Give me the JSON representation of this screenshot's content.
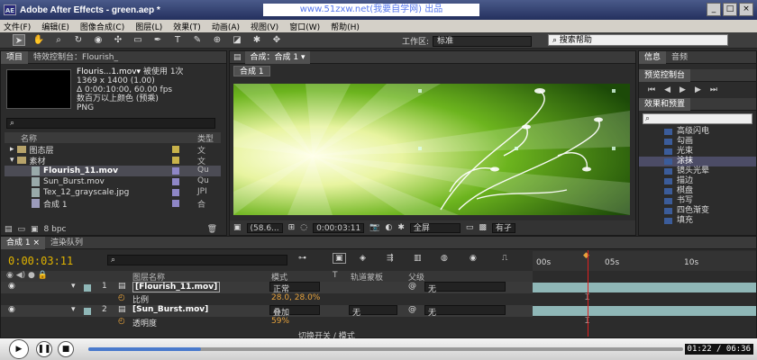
{
  "window": {
    "title": "Adobe After Effects - green.aep *",
    "watermark": "www.51zxw.net(我要自学网) 出品",
    "app_icon": "AE"
  },
  "menu": [
    "文件(F)",
    "编辑(E)",
    "图像合成(C)",
    "图层(L)",
    "效果(T)",
    "动画(A)",
    "视图(V)",
    "窗口(W)",
    "帮助(H)"
  ],
  "toolbar": {
    "workspace_label": "工作区:",
    "workspace_value": "标准",
    "help_search": "搜索帮助"
  },
  "project": {
    "tabs": [
      "项目",
      "特效控制台：Flourish_"
    ],
    "info": {
      "name": "Flouris...1.mov▾",
      "used": "被使用 1次",
      "dims": "1369 x 1400 (1.00)",
      "duration": "Δ 0:00:10:00, 60.00 fps",
      "color": "数百万以上颜色 (预乘)",
      "codec": "PNG"
    },
    "col_name": "名称",
    "col_type": "类型",
    "items": [
      {
        "name": "图态层",
        "type": "文",
        "kind": "folder",
        "color": "#c8b24a"
      },
      {
        "name": "素材",
        "type": "文",
        "kind": "folder",
        "color": "#c8b24a"
      },
      {
        "name": "Flourish_11.mov",
        "type": "Qu",
        "kind": "file",
        "color": "#8e86c6",
        "selected": true
      },
      {
        "name": "Sun_Burst.mov",
        "type": "Qu",
        "kind": "file",
        "color": "#8e86c6"
      },
      {
        "name": "Tex_12_grayscale.jpg",
        "type": "JPI",
        "kind": "file",
        "color": "#8e86c6"
      },
      {
        "name": "合成 1",
        "type": "合",
        "kind": "comp",
        "color": "#8e86c6"
      }
    ],
    "bpc": "8 bpc"
  },
  "comp": {
    "tab": "合成：合成 1 ▾",
    "subtab": "合成 1",
    "zoom": "(58.6...",
    "time": "0:00:03:11",
    "resolution": "全屏",
    "more": "有孑"
  },
  "right": {
    "tabs1": [
      "信息",
      "音频"
    ],
    "tabs2": [
      "预览控制台"
    ],
    "tabs3": [
      "效果和预置"
    ],
    "effects": [
      "高级闪电",
      "勾画",
      "光束",
      "涂抹",
      "镜头光晕",
      "描边",
      "棋盘",
      "书写",
      "四色渐变",
      "填充"
    ],
    "selected_effect": "涂抹"
  },
  "timeline": {
    "tabs": [
      "合成 1 ×",
      "渲染队列"
    ],
    "timecode": "0:00:03:11",
    "cols": [
      "图层名称",
      "模式",
      "T",
      "轨道蒙板",
      "父级"
    ],
    "layers": [
      {
        "num": "1",
        "name": "[Flourish_11.mov]",
        "mode": "正常",
        "parent": "无",
        "prop": "比例",
        "prop_value": "28.0, 28.0%"
      },
      {
        "num": "2",
        "name": "[Sun_Burst.mov]",
        "mode": "叠加",
        "track": "无",
        "parent": "无",
        "prop": "透明度",
        "prop_value": "59%"
      }
    ],
    "ruler": [
      "00s",
      "05s",
      "10s"
    ],
    "switch_label": "切换开关 / 模式"
  },
  "player": {
    "progress": 0.19,
    "time": "01:22 / 06:36"
  }
}
